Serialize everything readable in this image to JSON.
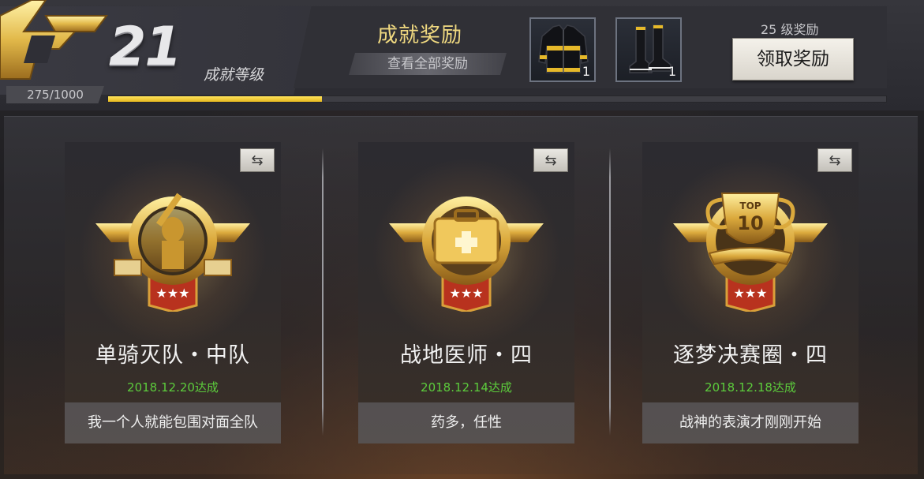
{
  "header": {
    "level": "21",
    "level_label": "成就等级",
    "xp_text": "275/1000",
    "xp_progress": 0.275,
    "reward_title": "成就奖励",
    "view_all_label": "查看全部奖励",
    "reward_items": [
      {
        "icon": "jacket-icon",
        "count": "1"
      },
      {
        "icon": "boots-icon",
        "count": "1"
      }
    ],
    "tier_label": "25 级奖励",
    "claim_label": "领取奖励"
  },
  "cards": [
    {
      "title": "单骑灭队・中队",
      "date": "2018.12.20达成",
      "description": "我一个人就能包围对面全队",
      "medal_icon": "soldier-medal-icon"
    },
    {
      "title": "战地医师・四",
      "date": "2018.12.14达成",
      "description": "药多，任性",
      "medal_icon": "medkit-medal-icon"
    },
    {
      "title": "逐梦决赛圈・四",
      "date": "2018.12.18达成",
      "description": "战神的表演才刚刚开始",
      "medal_icon": "trophy-medal-icon",
      "medal_text": [
        "TOP",
        "10"
      ]
    }
  ],
  "colors": {
    "gold": "#f0d980",
    "date_green": "#5ccc3c",
    "xp_fill": "#ffe45c"
  }
}
